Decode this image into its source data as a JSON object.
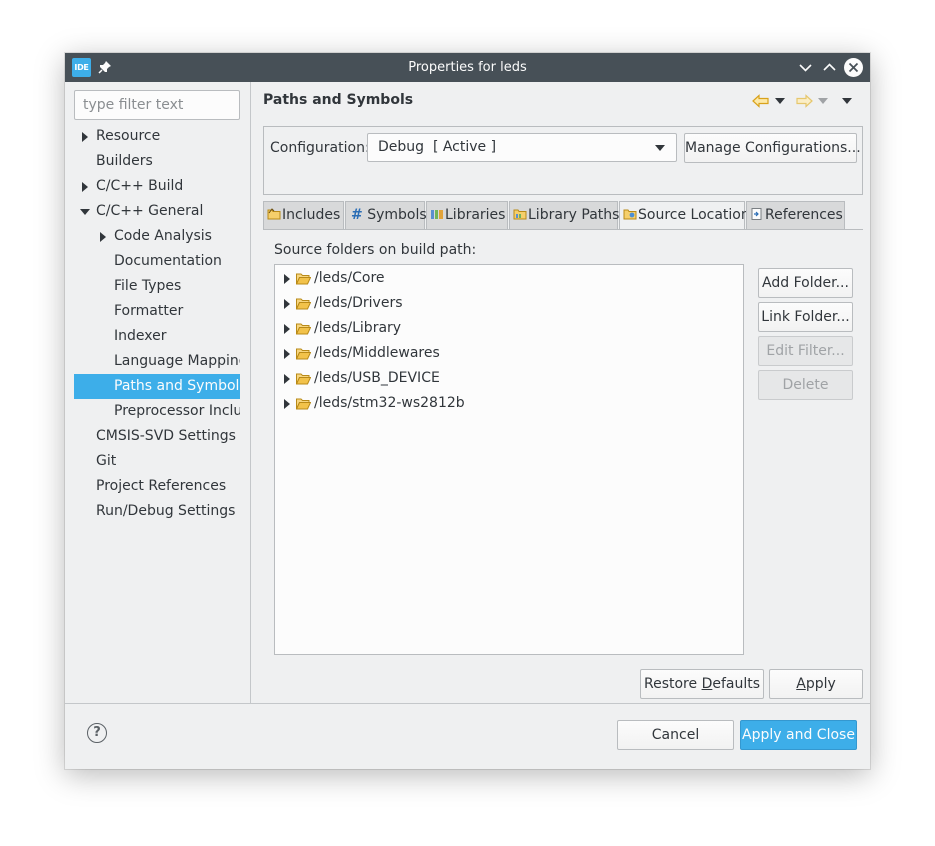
{
  "window": {
    "app_icon_text": "IDE",
    "title": "Properties for leds"
  },
  "sidebar": {
    "filter_placeholder": "type filter text",
    "items": [
      {
        "label": "Resource",
        "expander": "collapsed",
        "level": 0
      },
      {
        "label": "Builders",
        "expander": "none",
        "level": 0
      },
      {
        "label": "C/C++ Build",
        "expander": "collapsed",
        "level": 0
      },
      {
        "label": "C/C++ General",
        "expander": "expanded",
        "level": 0
      },
      {
        "label": "Code Analysis",
        "expander": "collapsed",
        "level": 1
      },
      {
        "label": "Documentation",
        "expander": "none",
        "level": 1
      },
      {
        "label": "File Types",
        "expander": "none",
        "level": 1
      },
      {
        "label": "Formatter",
        "expander": "none",
        "level": 1
      },
      {
        "label": "Indexer",
        "expander": "none",
        "level": 1
      },
      {
        "label": "Language Mappings",
        "expander": "none",
        "level": 1
      },
      {
        "label": "Paths and Symbols",
        "expander": "none",
        "level": 1,
        "selected": true
      },
      {
        "label": "Preprocessor Include",
        "expander": "none",
        "level": 1
      },
      {
        "label": "CMSIS-SVD Settings",
        "expander": "none",
        "level": 0
      },
      {
        "label": "Git",
        "expander": "none",
        "level": 0
      },
      {
        "label": "Project References",
        "expander": "none",
        "level": 0
      },
      {
        "label": "Run/Debug Settings",
        "expander": "none",
        "level": 0
      }
    ]
  },
  "main": {
    "page_title": "Paths and Symbols",
    "configuration_label": "Configuration:",
    "configuration_value": "Debug  [ Active ]",
    "manage_configurations": "Manage Configurations...",
    "tabs": [
      {
        "label": "Includes",
        "icon": "includes-icon"
      },
      {
        "label": "Symbols",
        "icon": "hash-icon",
        "glyph": "#"
      },
      {
        "label": "Libraries",
        "icon": "libraries-icon"
      },
      {
        "label": "Library Paths",
        "icon": "library-paths-icon"
      },
      {
        "label": "Source Location",
        "icon": "source-folder-icon",
        "active": true
      },
      {
        "label": "References",
        "icon": "references-icon"
      }
    ],
    "source_folders_label": "Source folders on build path:",
    "source_folders": [
      "/leds/Core",
      "/leds/Drivers",
      "/leds/Library",
      "/leds/Middlewares",
      "/leds/USB_DEVICE",
      "/leds/stm32-ws2812b"
    ],
    "side_buttons": {
      "add_folder": "Add Folder...",
      "link_folder": "Link Folder...",
      "edit_filter": "Edit Filter...",
      "delete": "Delete"
    },
    "restore_defaults_pre": "Restore ",
    "restore_defaults_mnemonic": "D",
    "restore_defaults_post": "efaults",
    "apply_mnemonic": "A",
    "apply_post": "pply"
  },
  "footer": {
    "help_glyph": "?",
    "cancel": "Cancel",
    "apply_and_close": "Apply and Close"
  },
  "colors": {
    "accent": "#3daee9",
    "titlebar": "#475057",
    "folder": "#f0b840"
  }
}
